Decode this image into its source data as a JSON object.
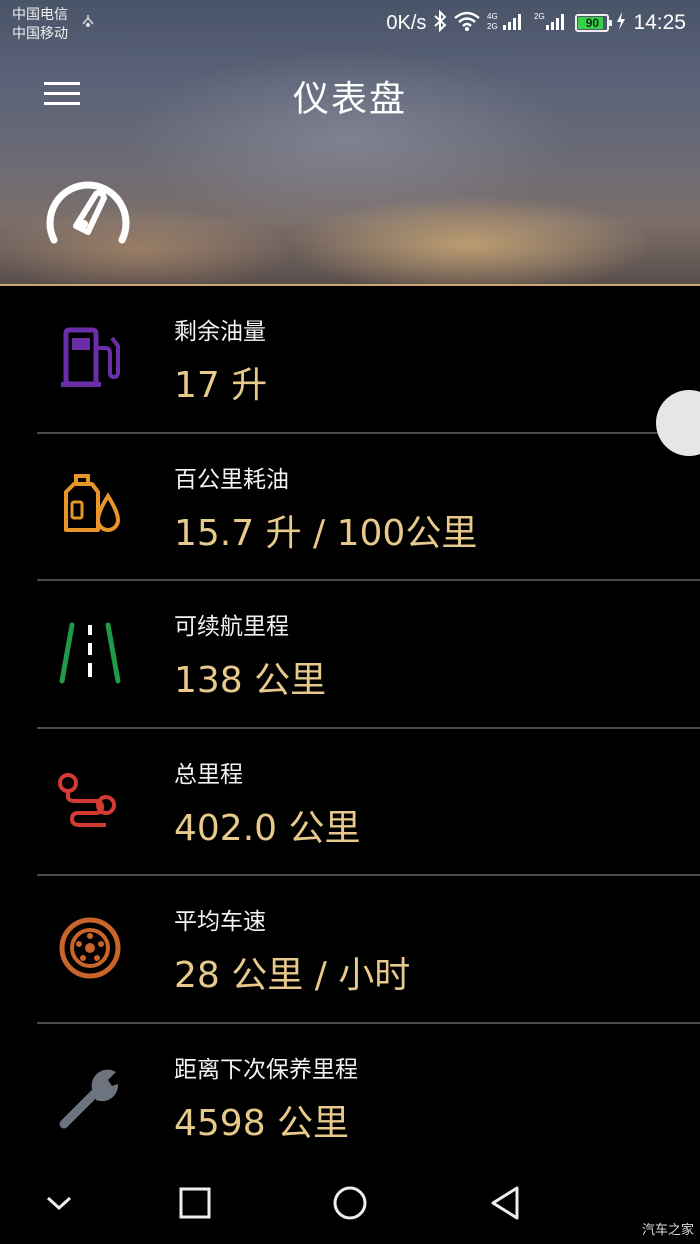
{
  "status_bar": {
    "carrier_1": "中国电信",
    "carrier_2": "中国移动",
    "net_speed": "0K/s",
    "battery": "90",
    "battery_level": 0.9,
    "time": "14:25"
  },
  "header": {
    "title": "仪表盘",
    "menu_icon": "hamburger-menu-icon",
    "gauge_icon": "speedometer-icon"
  },
  "items": [
    {
      "label": "剩余油量",
      "value": "17 升",
      "icon": "fuel-pump-icon",
      "color": "#6a2fa8"
    },
    {
      "label": "百公里耗油",
      "value": "15.7 升 / 100公里",
      "icon": "oil-can-icon",
      "color": "#e8952a"
    },
    {
      "label": "可续航里程",
      "value": "138 公里",
      "icon": "road-icon",
      "color": "#1f9a48"
    },
    {
      "label": "总里程",
      "value": "402.0 公里",
      "icon": "route-icon",
      "color": "#d23a32"
    },
    {
      "label": "平均车速",
      "value": "28 公里 / 小时",
      "icon": "wheel-icon",
      "color": "#c9642a"
    },
    {
      "label": "距离下次保养里程",
      "value": "4598 公里",
      "icon": "wrench-icon",
      "color": "#6d7480"
    }
  ],
  "nav_bar": {
    "back_icon": "back-triangle-icon",
    "home_icon": "home-circle-icon",
    "recents_icon": "recents-square-icon",
    "collapse_icon": "chevron-down-icon"
  },
  "watermark": "汽车之家",
  "colors": {
    "value_text": "#e6c98b",
    "divider": "#4a4a4a",
    "accent_line": "#c9a873"
  }
}
